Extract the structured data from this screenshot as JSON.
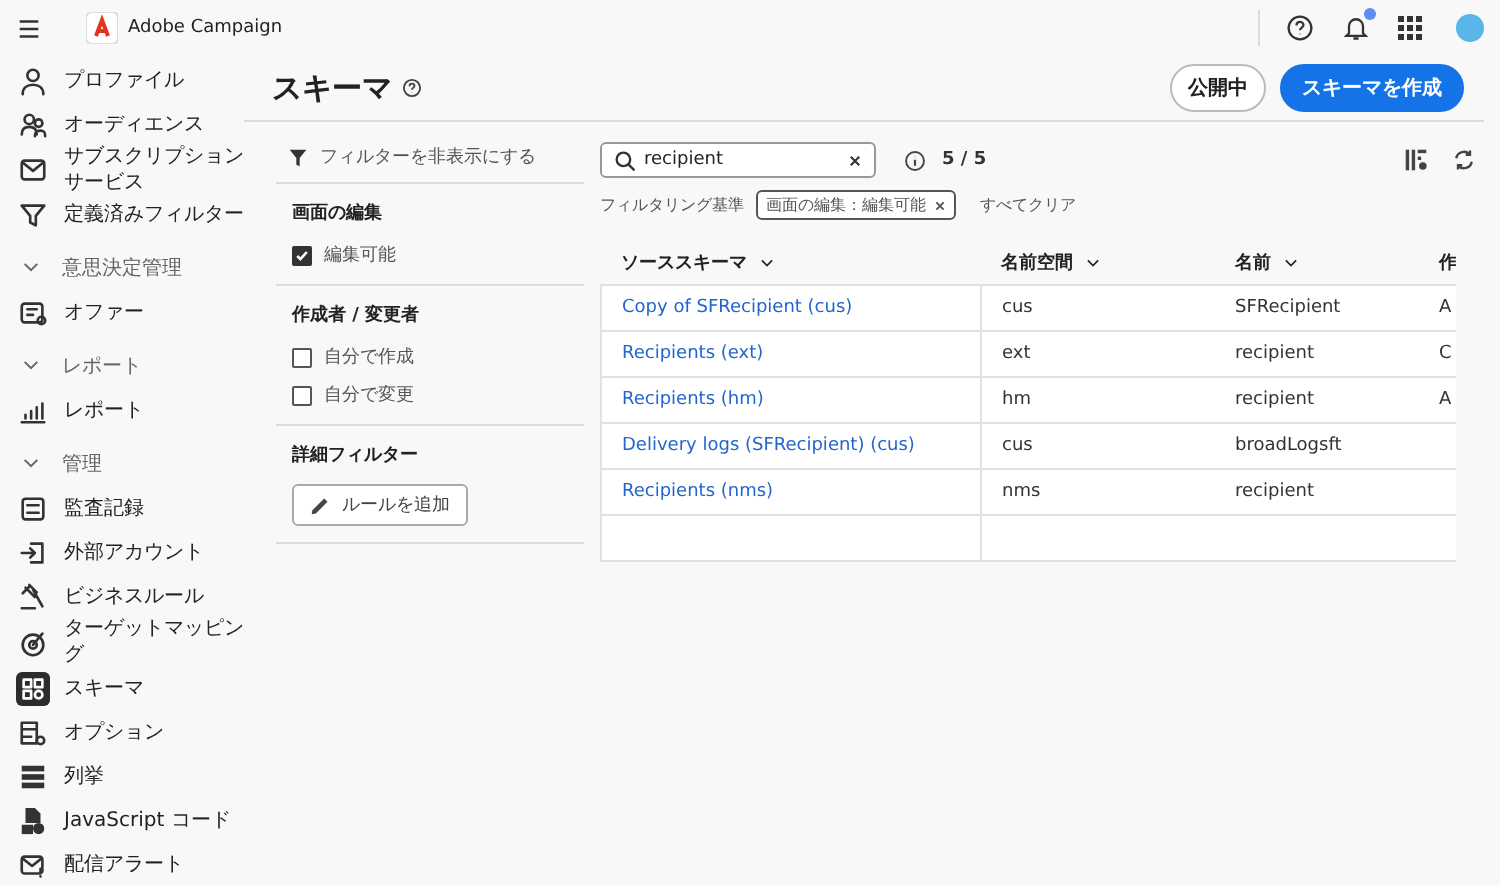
{
  "app": {
    "name": "Adobe Campaign",
    "notification_dot": true
  },
  "sidebar": {
    "items": [
      {
        "kind": "item",
        "label": "プロファイル",
        "selected": false
      },
      {
        "kind": "item",
        "label": "オーディエンス",
        "selected": false
      },
      {
        "kind": "item",
        "label": "サブスクリプションサービス",
        "selected": false
      },
      {
        "kind": "item",
        "label": "定義済みフィルター",
        "selected": false
      },
      {
        "kind": "section",
        "label": "意思決定管理",
        "expanded": true
      },
      {
        "kind": "item",
        "label": "オファー",
        "selected": false
      },
      {
        "kind": "section",
        "label": "レポート",
        "expanded": true
      },
      {
        "kind": "item",
        "label": "レポート",
        "selected": false
      },
      {
        "kind": "section",
        "label": "管理",
        "expanded": true
      },
      {
        "kind": "item",
        "label": "監査記録",
        "selected": false
      },
      {
        "kind": "item",
        "label": "外部アカウント",
        "selected": false
      },
      {
        "kind": "item",
        "label": "ビジネスルール",
        "selected": false
      },
      {
        "kind": "item",
        "label": "ターゲットマッピング",
        "selected": false
      },
      {
        "kind": "item",
        "label": "スキーマ",
        "selected": true
      },
      {
        "kind": "item",
        "label": "オプション",
        "selected": false
      },
      {
        "kind": "item",
        "label": "列挙",
        "selected": false
      },
      {
        "kind": "item",
        "label": "JavaScript コード",
        "selected": false
      },
      {
        "kind": "item",
        "label": "配信アラート",
        "selected": false
      }
    ]
  },
  "page": {
    "title": "スキーマ",
    "buttons": [
      {
        "label": "公開中",
        "kind": "secondary"
      },
      {
        "label": "スキーマを作成",
        "kind": "primary"
      }
    ]
  },
  "filters": {
    "toggle": "フィルターを非表示にする",
    "groups": [
      {
        "title": "画面の編集",
        "options": [
          {
            "label": "編集可能",
            "checked": true
          }
        ]
      },
      {
        "title": "作成者 / 変更者",
        "options": [
          {
            "label": "自分で作成",
            "checked": false
          },
          {
            "label": "自分で変更",
            "checked": false
          }
        ]
      },
      {
        "title": "詳細フィルター",
        "button": "ルールを追加"
      }
    ]
  },
  "search": {
    "value": "recipient",
    "count": "5 / 5"
  },
  "applied_filters": {
    "label": "フィルタリング基準",
    "chips": [
      "画面の編集：編集可能"
    ],
    "clear": "すべてクリア"
  },
  "table": {
    "columns": [
      {
        "label": "ソーススキーマ",
        "sortable": true
      },
      {
        "label": "名前空間",
        "sortable": true
      },
      {
        "label": "名前",
        "sortable": true
      },
      {
        "label": "作",
        "sortable": false
      }
    ],
    "rows": [
      [
        "Copy of SFRecipient (cus)",
        "cus",
        "SFRecipient",
        "A"
      ],
      [
        "Recipients (ext)",
        "ext",
        "recipient",
        "C"
      ],
      [
        "Recipients (hm)",
        "hm",
        "recipient",
        "A"
      ],
      [
        "Delivery logs (SFRecipient) (cus)",
        "cus",
        "broadLogsft",
        ""
      ],
      [
        "Recipients (nms)",
        "nms",
        "recipient",
        ""
      ]
    ]
  }
}
